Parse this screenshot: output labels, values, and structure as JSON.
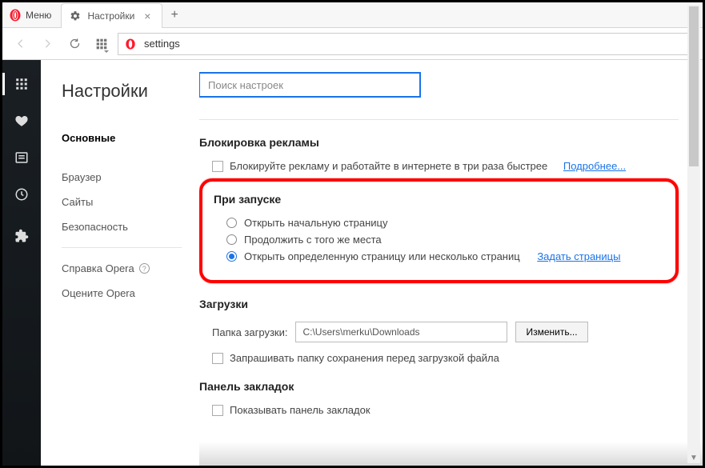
{
  "titlebar": {
    "menu_label": "Меню",
    "tab_label": "Настройки"
  },
  "addressbar": {
    "url": "settings"
  },
  "page": {
    "title": "Настройки"
  },
  "subnav": {
    "basic": "Основные",
    "browser": "Браузер",
    "sites": "Сайты",
    "security": "Безопасность",
    "help": "Справка Opera",
    "rate": "Оцените Opera"
  },
  "search": {
    "placeholder": "Поиск настроек"
  },
  "sections": {
    "adblock": {
      "title": "Блокировка рекламы",
      "checkbox_label": "Блокируйте рекламу и работайте в интернете в три раза быстрее",
      "more": "Подробнее..."
    },
    "startup": {
      "title": "При запуске",
      "opt1": "Открыть начальную страницу",
      "opt2": "Продолжить с того же места",
      "opt3": "Открыть определенную страницу или несколько страниц",
      "set_pages": "Задать страницы"
    },
    "downloads": {
      "title": "Загрузки",
      "folder_label": "Папка загрузки:",
      "folder_value": "C:\\Users\\merku\\Downloads",
      "change_btn": "Изменить...",
      "ask_label": "Запрашивать папку сохранения перед загрузкой файла"
    },
    "bookmarks": {
      "title": "Панель закладок",
      "show_label": "Показывать панель закладок"
    }
  }
}
